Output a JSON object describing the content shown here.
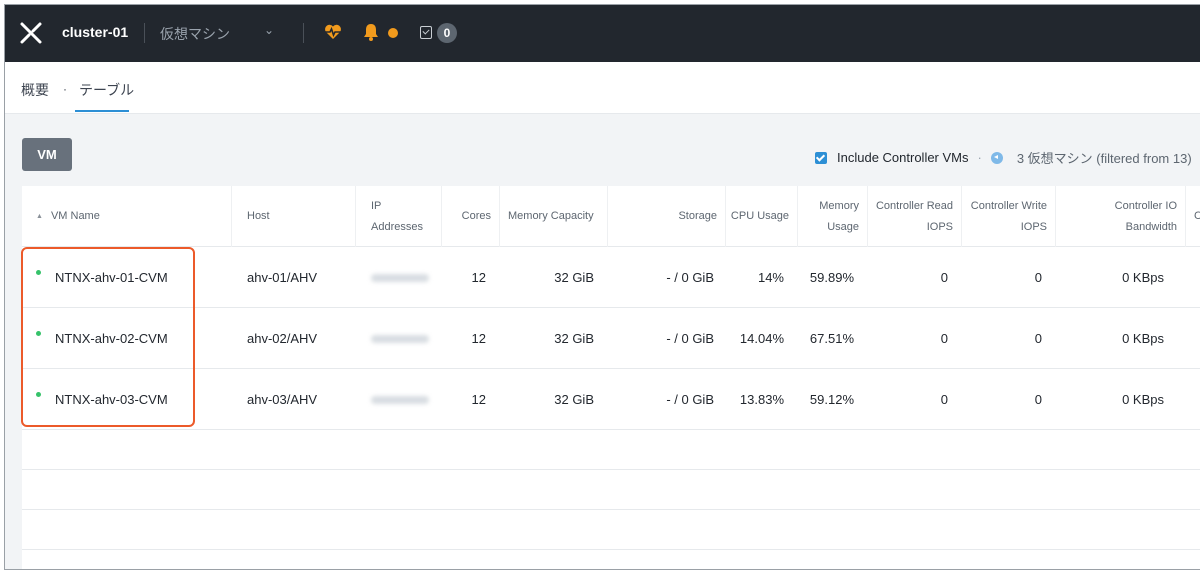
{
  "topbar": {
    "cluster_name": "cluster-01",
    "section_label": "仮想マシン",
    "task_count": "0",
    "colors": {
      "background": "#22272e",
      "health": "#f29b1d",
      "alert": "#f29b1d"
    }
  },
  "tabs": [
    {
      "label": "概要",
      "active": false
    },
    {
      "label": "テーブル",
      "active": true
    }
  ],
  "toolbar": {
    "vm_button": "VM",
    "include_cvm_label": "Include Controller VMs",
    "include_cvm_checked": true,
    "vm_count_text": "3 仮想マシン (filtered from 13)"
  },
  "table": {
    "headers": {
      "vm_name": "VM Name",
      "host": "Host",
      "ip_line1": "IP",
      "ip_line2": "Addresses",
      "cores": "Cores",
      "memory_capacity": "Memory Capacity",
      "storage": "Storage",
      "cpu_usage": "CPU Usage",
      "memory_usage_line1": "Memory",
      "memory_usage_line2": "Usage",
      "ctrl_read_line1": "Controller Read",
      "ctrl_read_line2": "IOPS",
      "ctrl_write_line1": "Controller Write",
      "ctrl_write_line2": "IOPS",
      "ctrl_io_line1": "Controller IO",
      "ctrl_io_line2": "Bandwidth",
      "next_cut": "C"
    },
    "rows": [
      {
        "name": "NTNX-ahv-01-CVM",
        "host": "ahv-01/AHV",
        "cores": "12",
        "memory": "32 GiB",
        "storage": "- / 0 GiB",
        "cpu_l1": "14%",
        "cpu_l2": "",
        "mem_l1": "59.89",
        "mem_l2": "%",
        "read": "0",
        "write": "0",
        "bandwidth": "0 KBps"
      },
      {
        "name": "NTNX-ahv-02-CVM",
        "host": "ahv-02/AHV",
        "cores": "12",
        "memory": "32 GiB",
        "storage": "- / 0 GiB",
        "cpu_l1": "14.04",
        "cpu_l2": "%",
        "mem_l1": "67.51%",
        "mem_l2": "",
        "read": "0",
        "write": "0",
        "bandwidth": "0 KBps"
      },
      {
        "name": "NTNX-ahv-03-CVM",
        "host": "ahv-03/AHV",
        "cores": "12",
        "memory": "32 GiB",
        "storage": "- / 0 GiB",
        "cpu_l1": "13.83",
        "cpu_l2": "%",
        "mem_l1": "59.12%",
        "mem_l2": "",
        "read": "0",
        "write": "0",
        "bandwidth": "0 KBps"
      }
    ]
  },
  "colors": {
    "accent": "#2d8fd5",
    "highlight": "#ec5a2a",
    "status_on": "#36c26a"
  }
}
